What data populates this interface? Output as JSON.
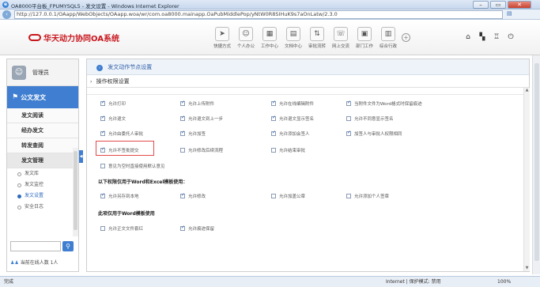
{
  "window": {
    "title": "OA8000平台板_FPUMYSQL5 - 发文设置 - Windows Internet Explorer",
    "url": "http://127.0.0.1/OAapp/WebObjects/OAapp.woa/wr/com.oa8000.mainapp.OaPubMiddlePop/yNtW0R8SIHuK9s7aOnLatw/2.3.0",
    "buttons": {
      "minimize": "–",
      "maximize": "▭",
      "close": "✕"
    }
  },
  "header": {
    "logo_text": "华天动力协同OA系统",
    "tools": [
      {
        "label": "快捷方式",
        "icon": "send-icon",
        "glyph": "➤"
      },
      {
        "label": "个人办公",
        "icon": "person-icon",
        "glyph": "☺"
      },
      {
        "label": "工作中心",
        "icon": "grid-icon",
        "glyph": "▦"
      },
      {
        "label": "文档中心",
        "icon": "document-icon",
        "glyph": "▤"
      },
      {
        "label": "审批流转",
        "icon": "flow-icon",
        "glyph": "⇅"
      },
      {
        "label": "网上交流",
        "icon": "chat-icon",
        "glyph": "☏"
      },
      {
        "label": "部门工作",
        "icon": "department-icon",
        "glyph": "▣"
      },
      {
        "label": "综合行政",
        "icon": "admin-icon",
        "glyph": "▥"
      }
    ],
    "add_glyph": "+",
    "right_controls": [
      {
        "name": "home-icon",
        "glyph": "⌂"
      },
      {
        "name": "org-icon",
        "glyph": "▚"
      },
      {
        "name": "shirt-icon",
        "glyph": "♖"
      },
      {
        "name": "power-icon",
        "glyph": "⏻"
      }
    ]
  },
  "sidebar": {
    "user_name": "管理员",
    "module_title": "公文发文",
    "menu": [
      {
        "label": "发文阅读"
      },
      {
        "label": "经办发文"
      },
      {
        "label": "转发查阅"
      },
      {
        "label": "发文管理"
      }
    ],
    "subitems": [
      {
        "label": "发文库"
      },
      {
        "label": "发文监控"
      },
      {
        "label": "发文设置"
      },
      {
        "label": "安全日志"
      }
    ],
    "online_text": "当前在线人数 1人"
  },
  "main": {
    "title": "发文动作节点设置",
    "section": "操作权限设置",
    "rows": [
      [
        {
          "label": "允许打印",
          "checked": true
        },
        {
          "label": "允许上传附件",
          "checked": true
        },
        {
          "label": "允许在线编辑附件",
          "checked": true
        },
        {
          "label": "当附件文件为Word格式时保留痕迹",
          "checked": true
        }
      ],
      [
        {
          "label": "允许退文",
          "checked": true
        },
        {
          "label": "允许退文到上一步",
          "checked": true
        },
        {
          "label": "允许退文显示签名",
          "checked": true
        },
        {
          "label": "允许不同意显示签名",
          "checked": false
        }
      ],
      [
        {
          "label": "允许由委托人审批",
          "checked": true
        },
        {
          "label": "允许加签",
          "checked": true
        },
        {
          "label": "允许添加会签人",
          "checked": true
        },
        {
          "label": "加签人与审批人权限相同",
          "checked": true
        }
      ],
      [
        {
          "label": "允许不签批提交",
          "checked": true
        },
        {
          "label": "允许修改后续流程",
          "checked": false
        },
        {
          "label": "允许结束审批",
          "checked": false
        }
      ],
      [
        {
          "label": "意见为空时直接使用默认意见",
          "checked": false
        }
      ]
    ],
    "group1": "以下权限仅用于Word和Excel模板使用：",
    "group1_rows": [
      {
        "label": "允许另存到本地",
        "checked": true
      },
      {
        "label": "允许修改",
        "checked": true
      },
      {
        "label": "允许加盖公章",
        "checked": false
      },
      {
        "label": "允许添加个人签章",
        "checked": false
      }
    ],
    "group2": "此项仅用于Word模板使用",
    "group2_rows": [
      {
        "label": "允许正文文件套红",
        "checked": false
      },
      {
        "label": "允许痕迹保留",
        "checked": true
      }
    ]
  },
  "statusbar": {
    "left": "完成",
    "zone": "Internet | 保护模式: 禁用",
    "zoom": "100%"
  }
}
